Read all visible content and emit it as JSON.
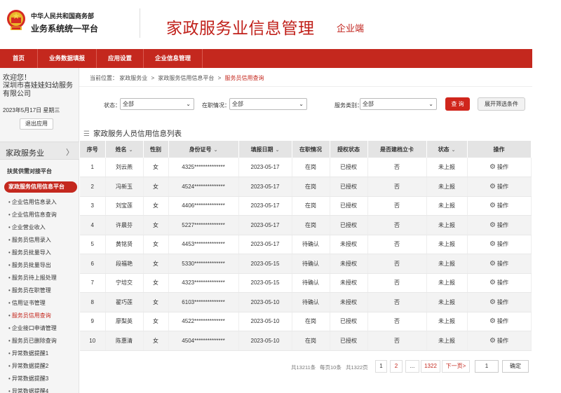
{
  "header": {
    "org_line1": "中华人民共和国商务部",
    "org_line2": "业务系统统一平台",
    "app_title": "家政服务业信息管理",
    "app_subtitle": "企业端"
  },
  "topnav": [
    "首页",
    "业务数据填报",
    "应用设置",
    "企业信息管理"
  ],
  "sidebar": {
    "welcome": "欢迎您！",
    "company": "深圳市喜娃娃妇幼服务有限公司",
    "date": "2023年5月17日 星期三",
    "logout": "退出应用",
    "section": "家政服务业",
    "menu_a": "扶贫供需对接平台",
    "menu_b": "家政服务信用信息平台",
    "items": [
      "企业信用信息录入",
      "企业信用信息查询",
      "企业营业收入",
      "服务员信用录入",
      "服务员批量导入",
      "服务员批量导出",
      "服务员待上报处理",
      "服务员在职管理",
      "信用证书管理",
      "服务员信用查询",
      "企业接口申请管理",
      "服务员已删除查询",
      "异常数据提醒1",
      "异常数据提醒2",
      "异常数据提醒3",
      "异常数据提醒4"
    ],
    "current_index": 9
  },
  "breadcrumb": {
    "prefix": "当前位置：",
    "l1": "家政服务业",
    "l2": "家政服务信用信息平台",
    "l3": "服务员信用查询",
    "sep": ">"
  },
  "filters": {
    "status_label": "状态：",
    "status_value": "全部",
    "employment_label": "在职情况：",
    "employment_value": "全部",
    "category_label": "服务类别：",
    "category_value": "全部",
    "query": "查 询",
    "expand": "展开筛选条件"
  },
  "list_title": "家政服务人员信用信息列表",
  "table": {
    "headers": [
      "序号",
      "姓名",
      "性别",
      "身份证号",
      "填报日期",
      "在职情况",
      "授权状态",
      "是否建档立卡",
      "状态",
      "操作"
    ],
    "sort_icon": "⌄",
    "rows": [
      [
        "1",
        "刘云燕",
        "女",
        "4325**************",
        "2023-05-17",
        "在岗",
        "已授权",
        "否",
        "未上报",
        "操作"
      ],
      [
        "2",
        "冯新玉",
        "女",
        "4524**************",
        "2023-05-17",
        "在岗",
        "已授权",
        "否",
        "未上报",
        "操作"
      ],
      [
        "3",
        "刘宝莲",
        "女",
        "4406**************",
        "2023-05-17",
        "在岗",
        "已授权",
        "否",
        "未上报",
        "操作"
      ],
      [
        "4",
        "许晨芬",
        "女",
        "5227**************",
        "2023-05-17",
        "在岗",
        "已授权",
        "否",
        "未上报",
        "操作"
      ],
      [
        "5",
        "黄铭贤",
        "女",
        "4453**************",
        "2023-05-17",
        "待确认",
        "未授权",
        "否",
        "未上报",
        "操作"
      ],
      [
        "6",
        "段福艳",
        "女",
        "5330**************",
        "2023-05-15",
        "待确认",
        "未授权",
        "否",
        "未上报",
        "操作"
      ],
      [
        "7",
        "宁培交",
        "女",
        "4323**************",
        "2023-05-15",
        "待确认",
        "未授权",
        "否",
        "未上报",
        "操作"
      ],
      [
        "8",
        "翟巧莲",
        "女",
        "6103**************",
        "2023-05-10",
        "待确认",
        "未授权",
        "否",
        "未上报",
        "操作"
      ],
      [
        "9",
        "廖梨英",
        "女",
        "4522**************",
        "2023-05-10",
        "在岗",
        "已授权",
        "否",
        "未上报",
        "操作"
      ],
      [
        "10",
        "陈惠清",
        "女",
        "4504**************",
        "2023-05-10",
        "在岗",
        "已授权",
        "否",
        "未上报",
        "操作"
      ]
    ]
  },
  "pager": {
    "total_records": "共13211条",
    "per_page": "每页10条",
    "total_pages": "共1322页",
    "p1": "1",
    "p2": "2",
    "ellipsis": "...",
    "last": "1322",
    "next": "下一页>",
    "input_value": "1",
    "confirm": "确定"
  },
  "colors": {
    "brand_red": "#c4281e",
    "query_red": "#d0261c"
  }
}
